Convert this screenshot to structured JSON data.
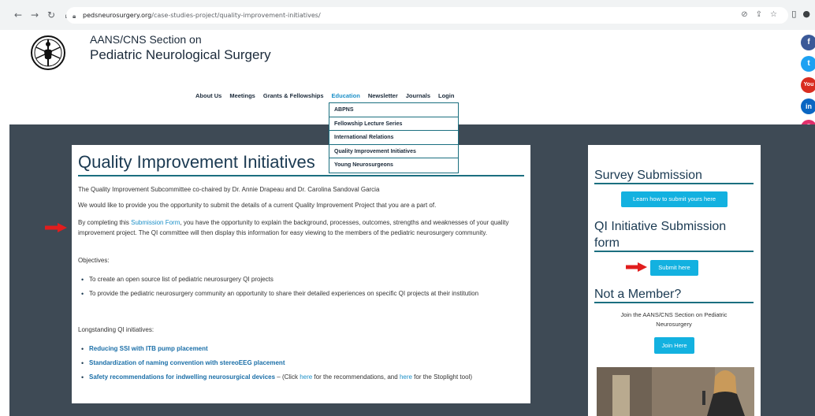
{
  "browser": {
    "url_host": "pedsneurosurgery.org",
    "url_path": "/case-studies-project/quality-improvement-initiatives/",
    "icons": [
      "back-icon",
      "forward-icon",
      "reload-icon",
      "home-icon",
      "lock-icon",
      "eye-off-icon",
      "share-icon",
      "star-icon",
      "sidebar-icon",
      "profile-icon"
    ]
  },
  "header": {
    "org_line1": "AANS/CNS Section on",
    "org_line2": "Pediatric Neurological Surgery",
    "nav": [
      "About Us",
      "Meetings",
      "Grants & Fellowships",
      "Education",
      "Newsletter",
      "Journals",
      "Login"
    ],
    "active_nav": "Education"
  },
  "dropdown": {
    "items": [
      "ABPNS",
      "Fellowship Lecture Series",
      "International Relations",
      "Quality Improvement Initiatives",
      "Young Neurosurgeons"
    ]
  },
  "social": {
    "items": [
      {
        "name": "facebook-icon",
        "glyph": "f",
        "color": "#3b5998"
      },
      {
        "name": "twitter-icon",
        "glyph": "t",
        "color": "#1da1f2"
      },
      {
        "name": "youtube-icon",
        "glyph": "You",
        "color": "#d92d20"
      },
      {
        "name": "linkedin-icon",
        "glyph": "in",
        "color": "#0a66c2"
      },
      {
        "name": "instagram-icon",
        "glyph": "◎",
        "color": "#e1306c"
      }
    ]
  },
  "main": {
    "title": "Quality Improvement Initiatives",
    "p1": "The Quality Improvement Subcommittee co-chaired by Dr. Annie Drapeau and Dr. Carolina Sandoval Garcia",
    "p2": "We would like to provide you the opportunity to submit the details of a current Quality Improvement Project that you are a part of.",
    "p3_before": "By completing this ",
    "p3_link": "Submission Form",
    "p3_after": ", you have the opportunity to explain the background, processes, outcomes, strengths and weaknesses of your quality improvement project. The QI committee will then display this information for easy viewing to the members of the pediatric neurosurgery community.",
    "objectives_label": "Objectives:",
    "objectives": [
      "To create an open source list of pediatric neurosurgery QI projects",
      "To provide the pediatric neurosurgery community an opportunity to share their detailed experiences on specific QI projects at their institution"
    ],
    "longstanding_label": "Longstanding QI initiatives:",
    "initiatives": [
      "Reducing SSI with ITB pump placement",
      "Standardization of naming convention with stereoEEG placement",
      "Safety recommendations for indwelling neurosurgical devices"
    ],
    "init3_text1": " – (Click ",
    "init3_link1": "here",
    "init3_text2": " for the recommendations, and ",
    "init3_link2": "here",
    "init3_text3": " for the Stoplight tool)"
  },
  "sidebar": {
    "survey_title": "Survey Submission",
    "survey_button": "Learn how to submit yours here",
    "qi_title_line1": "QI Initiative Submission",
    "qi_title_line2": "form",
    "qi_button": "Submit here",
    "member_title": "Not a Member?",
    "member_text": "Join the AANS/CNS Section on Pediatric Neurosurgery",
    "member_button": "Join Here"
  },
  "colors": {
    "accent": "#1b8fc7",
    "button": "#13b1e0",
    "band": "#3e4a55",
    "arrow": "#e11d1d"
  }
}
